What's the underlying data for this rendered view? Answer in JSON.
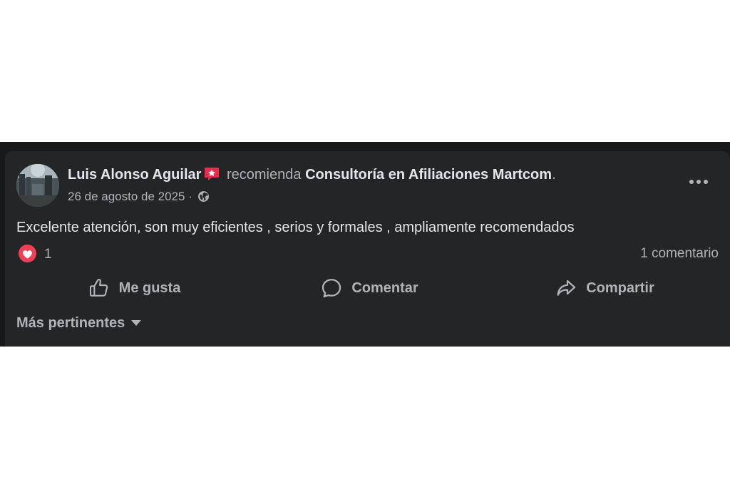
{
  "post": {
    "author": "Luis Alonso Aguilar",
    "verb": "recomienda",
    "page": "Consultoría en Afiliaciones Martcom",
    "page_suffix": ".",
    "date": "26 de agosto de 2025",
    "separator": "·",
    "privacy_icon": "globe-icon",
    "body": "Excelente atención, son muy eficientes , serios y formales , ampliamente recomendados"
  },
  "reactions": {
    "icon": "love-reaction-icon",
    "count": "1",
    "comments": "1 comentario"
  },
  "actions": {
    "like": "Me gusta",
    "comment": "Comentar",
    "share": "Compartir"
  },
  "sort": {
    "label": "Más pertinentes"
  },
  "colors": {
    "background": "#242526",
    "text_primary": "#e4e6eb",
    "text_secondary": "#b0b3b8",
    "recommend_badge": "#f02849",
    "love_reaction": "#f33e58"
  }
}
